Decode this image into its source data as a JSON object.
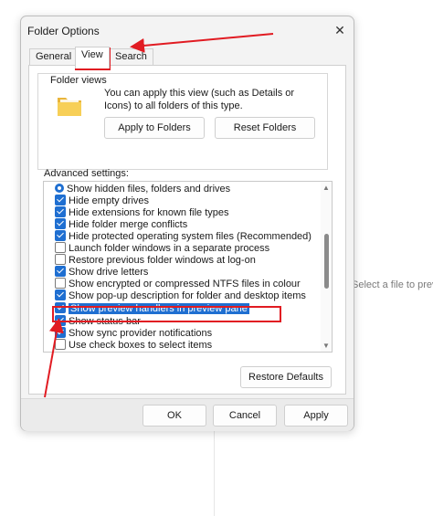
{
  "background": {
    "right_text": "Select a file to prev"
  },
  "dialog": {
    "title": "Folder Options",
    "close_label": "✕",
    "tabs": [
      {
        "label": "General",
        "active": false
      },
      {
        "label": "View",
        "active": true
      },
      {
        "label": "Search",
        "active": false
      }
    ],
    "folder_views": {
      "label": "Folder views",
      "description": "You can apply this view (such as Details or Icons) to all folders of this type.",
      "apply_button": "Apply to Folders",
      "reset_button": "Reset Folders"
    },
    "advanced": {
      "label": "Advanced settings:",
      "items": [
        {
          "type": "radio",
          "checked": true,
          "label": "Show hidden files, folders and drives"
        },
        {
          "type": "checkbox",
          "checked": true,
          "label": "Hide empty drives"
        },
        {
          "type": "checkbox",
          "checked": true,
          "label": "Hide extensions for known file types"
        },
        {
          "type": "checkbox",
          "checked": true,
          "label": "Hide folder merge conflicts"
        },
        {
          "type": "checkbox",
          "checked": true,
          "label": "Hide protected operating system files (Recommended)"
        },
        {
          "type": "checkbox",
          "checked": false,
          "label": "Launch folder windows in a separate process"
        },
        {
          "type": "checkbox",
          "checked": false,
          "label": "Restore previous folder windows at log-on"
        },
        {
          "type": "checkbox",
          "checked": true,
          "label": "Show drive letters"
        },
        {
          "type": "checkbox",
          "checked": false,
          "label": "Show encrypted or compressed NTFS files in colour"
        },
        {
          "type": "checkbox",
          "checked": true,
          "label": "Show pop-up description for folder and desktop items"
        },
        {
          "type": "checkbox",
          "checked": true,
          "label": "Show preview handlers in preview pane",
          "highlighted": true
        },
        {
          "type": "checkbox",
          "checked": true,
          "label": "Show status bar"
        },
        {
          "type": "checkbox",
          "checked": true,
          "label": "Show sync provider notifications"
        },
        {
          "type": "checkbox",
          "checked": false,
          "label": "Use check boxes to select items"
        }
      ]
    },
    "restore_defaults": "Restore Defaults",
    "ok": "OK",
    "cancel": "Cancel",
    "apply": "Apply"
  },
  "colors": {
    "accent": "#1f6fd1",
    "annotation": "#e11b22"
  }
}
